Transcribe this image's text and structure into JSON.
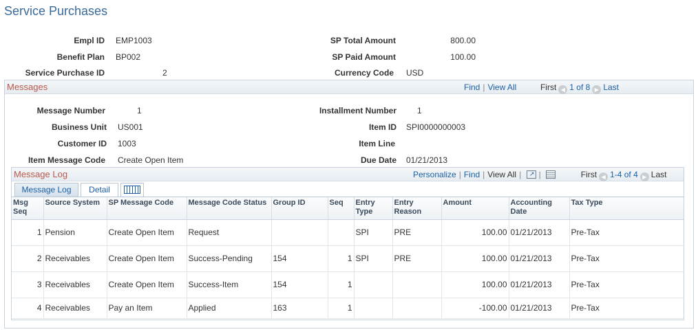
{
  "page_title": "Service Purchases",
  "header_fields": {
    "empl_id_label": "Empl ID",
    "empl_id": "EMP1003",
    "benefit_plan_label": "Benefit Plan",
    "benefit_plan": "BP002",
    "service_purchase_id_label": "Service Purchase ID",
    "service_purchase_id": "2",
    "sp_total_amount_label": "SP Total Amount",
    "sp_total_amount": "800.00",
    "sp_paid_amount_label": "SP Paid Amount",
    "sp_paid_amount": "100.00",
    "currency_code_label": "Currency Code",
    "currency_code": "USD"
  },
  "messages": {
    "title": "Messages",
    "find": "Find",
    "view_all": "View All",
    "first": "First",
    "range": "1 of 8",
    "last": "Last",
    "message_number_label": "Message Number",
    "message_number": "1",
    "business_unit_label": "Business Unit",
    "business_unit": "US001",
    "customer_id_label": "Customer ID",
    "customer_id": "1003",
    "item_message_code_label": "Item Message Code",
    "item_message_code": "Create Open Item",
    "installment_number_label": "Installment Number",
    "installment_number": "1",
    "item_id_label": "Item ID",
    "item_id": "SPI0000000003",
    "item_line_label": "Item Line",
    "item_line": "",
    "due_date_label": "Due Date",
    "due_date": "01/21/2013"
  },
  "message_log": {
    "title": "Message Log",
    "personalize": "Personalize",
    "find": "Find",
    "view_all": "View All",
    "first": "First",
    "range": "1-4 of 4",
    "last": "Last",
    "tabs": [
      "Message Log",
      "Detail"
    ],
    "icons": [
      "zoom-grid-icon",
      "download-icon",
      "show-all-columns-icon",
      "prev-icon",
      "next-icon"
    ],
    "columns": [
      "Msg Seq",
      "Source System",
      "SP Message Code",
      "Message Code Status",
      "Group ID",
      "Seq",
      "Entry Type",
      "Entry Reason",
      "Amount",
      "Accounting Date",
      "Tax Type"
    ],
    "rows": [
      [
        "1",
        "Pension",
        "Create Open Item",
        "Request",
        "",
        "",
        "SPI",
        "PRE",
        "100.00",
        "01/21/2013",
        "Pre-Tax"
      ],
      [
        "2",
        "Receivables",
        "Create Open Item",
        "Success-Pending",
        "154",
        "1",
        "SPI",
        "PRE",
        "100.00",
        "01/21/2013",
        "Pre-Tax"
      ],
      [
        "3",
        "Receivables",
        "Create Open Item",
        "Success-Item",
        "154",
        "1",
        "",
        "",
        "100.00",
        "01/21/2013",
        "Pre-Tax"
      ],
      [
        "4",
        "Receivables",
        "Pay an Item",
        "Applied",
        "163",
        "1",
        "",
        "",
        "-100.00",
        "01/21/2013",
        "Pre-Tax"
      ]
    ]
  }
}
